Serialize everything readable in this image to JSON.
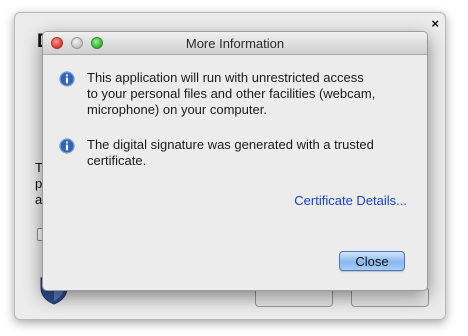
{
  "background_dialog": {
    "title_fragment": "D",
    "text_fragments": [
      "T",
      "p",
      "a"
    ],
    "close_glyph": "×"
  },
  "dialog": {
    "title": "More Information",
    "messages": [
      {
        "icon": "info-icon",
        "text": "This application will run with unrestricted access\nto your personal files and other facilities (webcam,\nmicrophone) on your computer."
      },
      {
        "icon": "info-icon",
        "text": "The digital signature was generated with a trusted\ncertificate."
      }
    ],
    "certificate_link": "Certificate Details...",
    "close_button": "Close"
  },
  "colors": {
    "link": "#1a3fcf",
    "info_icon": "#2f63b8",
    "default_button": "#89b8ee"
  }
}
